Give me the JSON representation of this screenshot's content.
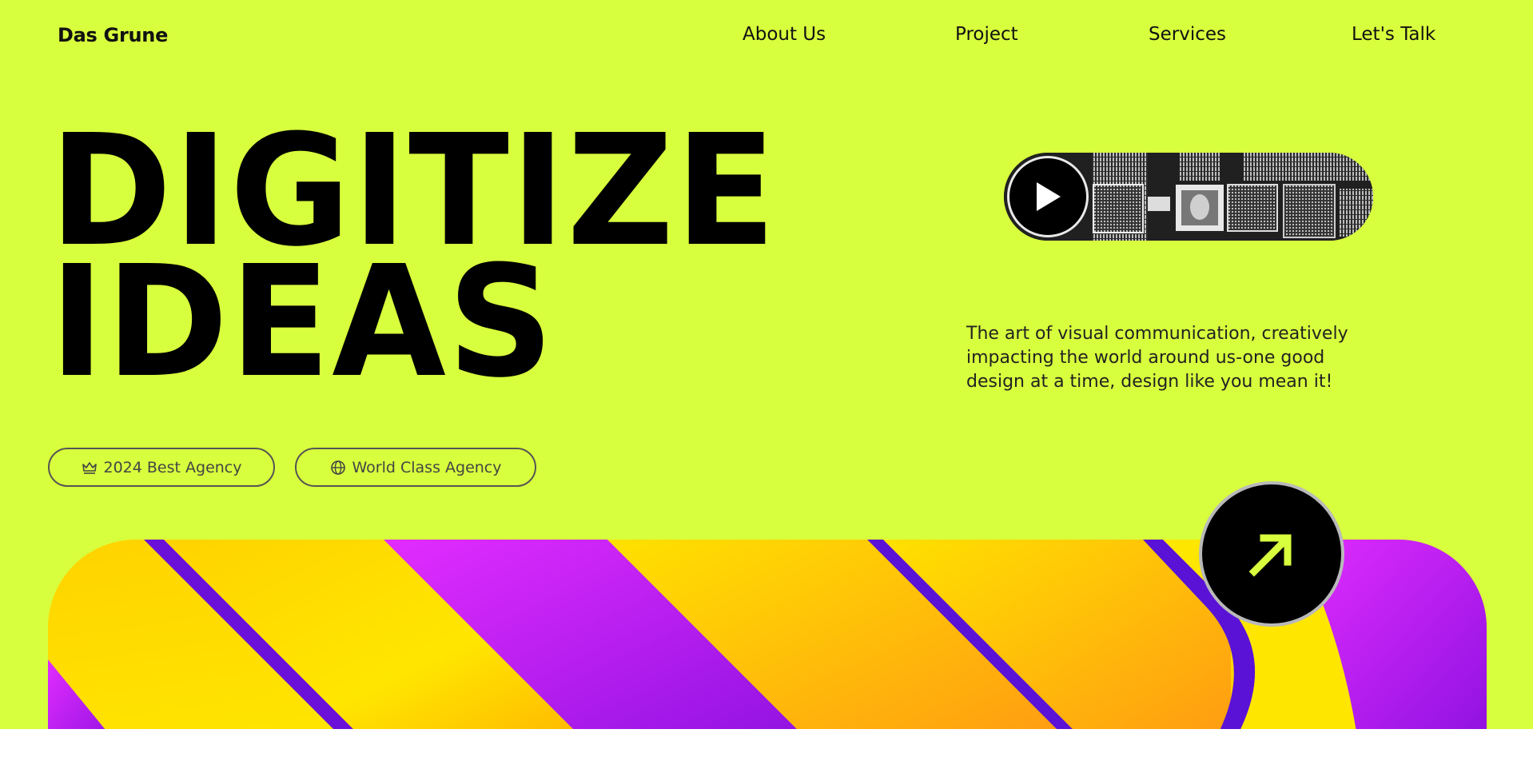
{
  "brand": {
    "name": "Das Grune"
  },
  "nav": {
    "links": [
      {
        "label": "About Us"
      },
      {
        "label": "Project"
      },
      {
        "label": "Services"
      },
      {
        "label": "Let's Talk"
      }
    ]
  },
  "hero": {
    "title_line1": "DIGITIZE",
    "title_line2": "IDEAS",
    "description": "The art of visual communication, creatively impacting the world around us-one good design at a time, design like you mean it!",
    "video": {
      "icon": "play-icon"
    },
    "badges": [
      {
        "icon": "crown-icon",
        "label": "2024 Best Agency"
      },
      {
        "icon": "globe-icon",
        "label": "World Class Agency"
      }
    ],
    "cta": {
      "icon": "arrow-up-right-icon"
    }
  },
  "colors": {
    "background": "#d8ff3d",
    "text": "#000000",
    "banner_yellow": "#ffe600",
    "banner_orange": "#ffa31a",
    "banner_purple": "#c51ff0",
    "banner_violet": "#5a12d6"
  }
}
